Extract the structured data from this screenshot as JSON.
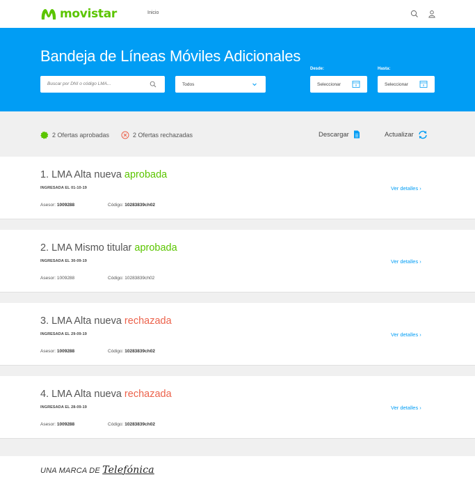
{
  "header": {
    "brand": "movistar",
    "nav_label": "Inicio",
    "icons": [
      "search-icon",
      "user-icon"
    ]
  },
  "hero": {
    "title": "Bandeja de Líneas Móviles Adicionales",
    "search_placeholder": "Buscar por DNI o código LMA...",
    "filter_value": "Todos",
    "from_label": "Desde:",
    "from_value": "Seleccionar",
    "to_label": "Hasta:",
    "to_value": "Seleccionar"
  },
  "summary": {
    "approved": "2 Ofertas aprobadas",
    "rejected": "2 Ofertas rechazadas",
    "download": "Descargar",
    "refresh": "Actualizar"
  },
  "cards": [
    {
      "title": "1. LMA Alta nueva",
      "status": "aprobada",
      "status_type": "ok",
      "date": "INGRESADA EL 01-10-19",
      "asesor_label": "Asesor:",
      "asesor": "1009288",
      "codigo_label": "Código:",
      "codigo": "10283839ch02",
      "link": "Ver detalles ›"
    },
    {
      "title": "2. LMA Mismo titular",
      "status": "aprobada",
      "status_type": "ok",
      "date": "INGRESADA EL 30-09-19",
      "asesor_label": "Asesor:",
      "asesor": "1009288",
      "codigo_label": "Código:",
      "codigo": "10283839ch02",
      "link": "Ver detalles ›"
    },
    {
      "title": "3. LMA Alta nueva",
      "status": "rechazada",
      "status_type": "ko",
      "date": "INGRESADA EL 29-09-19",
      "asesor_label": "Asesor:",
      "asesor": "1009288",
      "codigo_label": "Código:",
      "codigo": "10283839ch02",
      "link": "Ver detalles ›"
    },
    {
      "title": "4. LMA Alta nueva",
      "status": "rechazada",
      "status_type": "ko",
      "date": "INGRESADA EL 28-09-19",
      "asesor_label": "Asesor:",
      "asesor": "1009288",
      "codigo_label": "Código:",
      "codigo": "10283839ch02",
      "link": "Ver detalles ›"
    }
  ],
  "footer": {
    "prefix": "UNA MARCA DE",
    "brand": "Telefónica"
  },
  "colors": {
    "brand_blue": "#019df4",
    "brand_green": "#5bc500",
    "rejected_red": "#ec624b"
  }
}
